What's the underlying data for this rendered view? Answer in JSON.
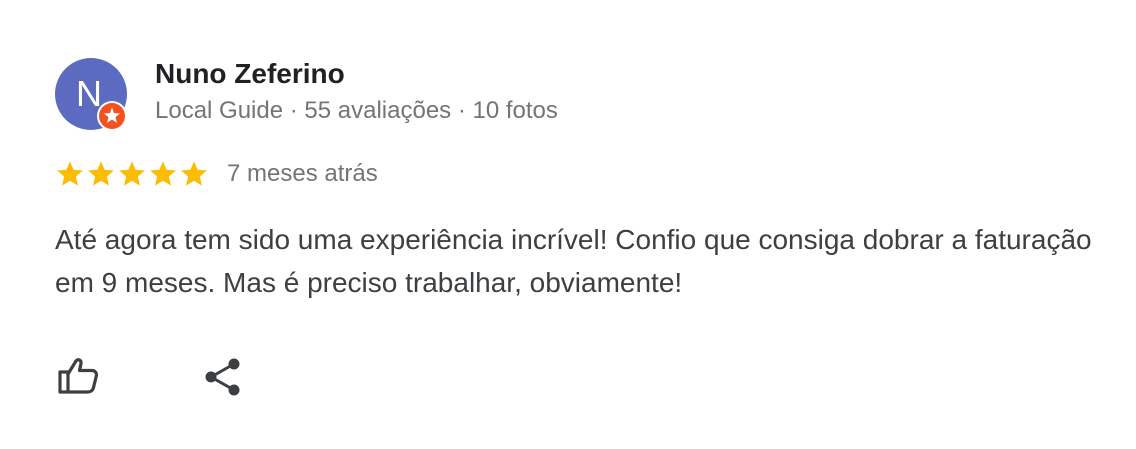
{
  "reviewer": {
    "initial": "N",
    "name": "Nuno Zeferino",
    "meta": "Local Guide · 55 avaliações · 10 fotos",
    "avatar_color": "#5c6bc0",
    "badge_color": "#f4511e"
  },
  "rating": {
    "stars": 5,
    "max_stars": 5,
    "star_color": "#fbbc04",
    "date": "7 meses atrás"
  },
  "review": {
    "text": "Até agora tem sido uma experiência incrível! Confio que consiga dobrar a faturação em 9 meses. Mas é preciso trabalhar, obviamente!"
  },
  "actions": [
    {
      "icon": "thumbs-up-icon"
    },
    {
      "icon": "share-icon"
    }
  ]
}
